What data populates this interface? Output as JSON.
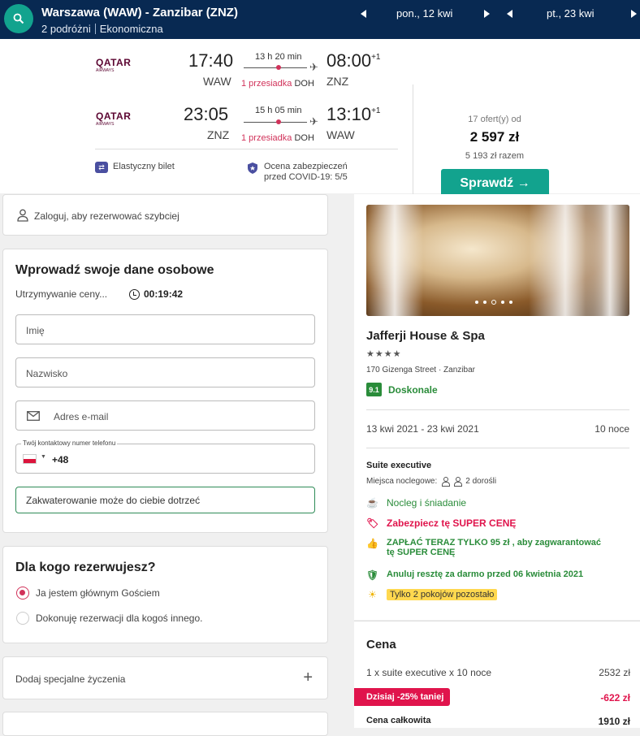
{
  "header": {
    "route": "Warszawa (WAW) - Zanzibar (ZNZ)",
    "travellers": "2 podróżni",
    "cabin": "Ekonomiczna",
    "depart_date": "pon., 12 kwi",
    "return_date": "pt., 23 kwi"
  },
  "flight": {
    "outbound": {
      "airline": "QATAR",
      "airline_sub": "AIRWAYS",
      "dep_time": "17:40",
      "dep_airport": "WAW",
      "duration": "13 h 20 min",
      "stops": "1 przesiadka",
      "stop_airport": "DOH",
      "arr_time": "08:00",
      "arr_offset": "+1",
      "arr_airport": "ZNZ"
    },
    "inbound": {
      "airline": "QATAR",
      "airline_sub": "AIRWAYS",
      "dep_time": "23:05",
      "dep_airport": "ZNZ",
      "duration": "15 h 05 min",
      "stops": "1 przesiadka",
      "stop_airport": "DOH",
      "arr_time": "13:10",
      "arr_offset": "+1",
      "arr_airport": "WAW"
    },
    "flex": "Elastyczny bilet",
    "covid_line1": "Ocena zabezpieczeń",
    "covid_line2": "przed COVID-19: 5/5",
    "offers": "17 ofert(y) od",
    "price": "2 597 zł",
    "total": "5 193 zł razem",
    "check_label": "Sprawdź →"
  },
  "login": {
    "text": "Zaloguj, aby rezerwować szybciej"
  },
  "personal": {
    "title": "Wprowadź swoje dane osobowe",
    "hold": "Utrzymywanie ceny...",
    "timer": "00:19:42",
    "first_name": "Imię",
    "last_name": "Nazwisko",
    "email": "Adres e-mail",
    "phone_label": "Twój kontaktowy numer telefonu",
    "phone_prefix": "+48",
    "tip": "Zakwaterowanie może do ciebie dotrzeć"
  },
  "who": {
    "title": "Dla kogo rezerwujesz?",
    "option1": "Ja jestem głównym Gościem",
    "option2": "Dokonuję rezerwacji dla kogoś innego."
  },
  "special": {
    "text": "Dodaj specjalne życzenia",
    "plus": "+"
  },
  "hotel": {
    "name": "Jafferji House & Spa",
    "stars": "★★★★",
    "address": "170 Gizenga Street · Zanzibar",
    "score": "9.1",
    "score_label": "Doskonale",
    "dates": "13 kwi 2021 - 23 kwi 2021",
    "nights": "10 noce",
    "room": "Suite executive",
    "beds_label": "Miejsca noclegowe:",
    "beds_value": "2 dorośli",
    "perk_breakfast": "Nocleg i śniadanie",
    "perk_secure": "Zabezpiecz tę SUPER CENĘ",
    "perk_pay_line1": "ZAPŁAĆ TERAZ TYLKO 95 zł , aby zagwarantować",
    "perk_pay_line2": "tę SUPER CENĘ",
    "perk_cancel": "Anuluj resztę za darmo przed 06 kwietnia 2021",
    "perk_rooms": "Tylko 2 pokojów pozostało"
  },
  "pricing": {
    "title": "Cena",
    "line_label": "1 x suite executive x 10 noce",
    "line_value": "2532 zł",
    "discount_label": "Dzisiaj -25% taniej",
    "discount_value": "-622 zł",
    "total_label": "Cena całkowita",
    "total_value": "1910 zł"
  },
  "colors": {
    "navy": "#082952",
    "teal": "#12a38e",
    "pink": "#e0144c",
    "green": "#2a8c3a"
  }
}
